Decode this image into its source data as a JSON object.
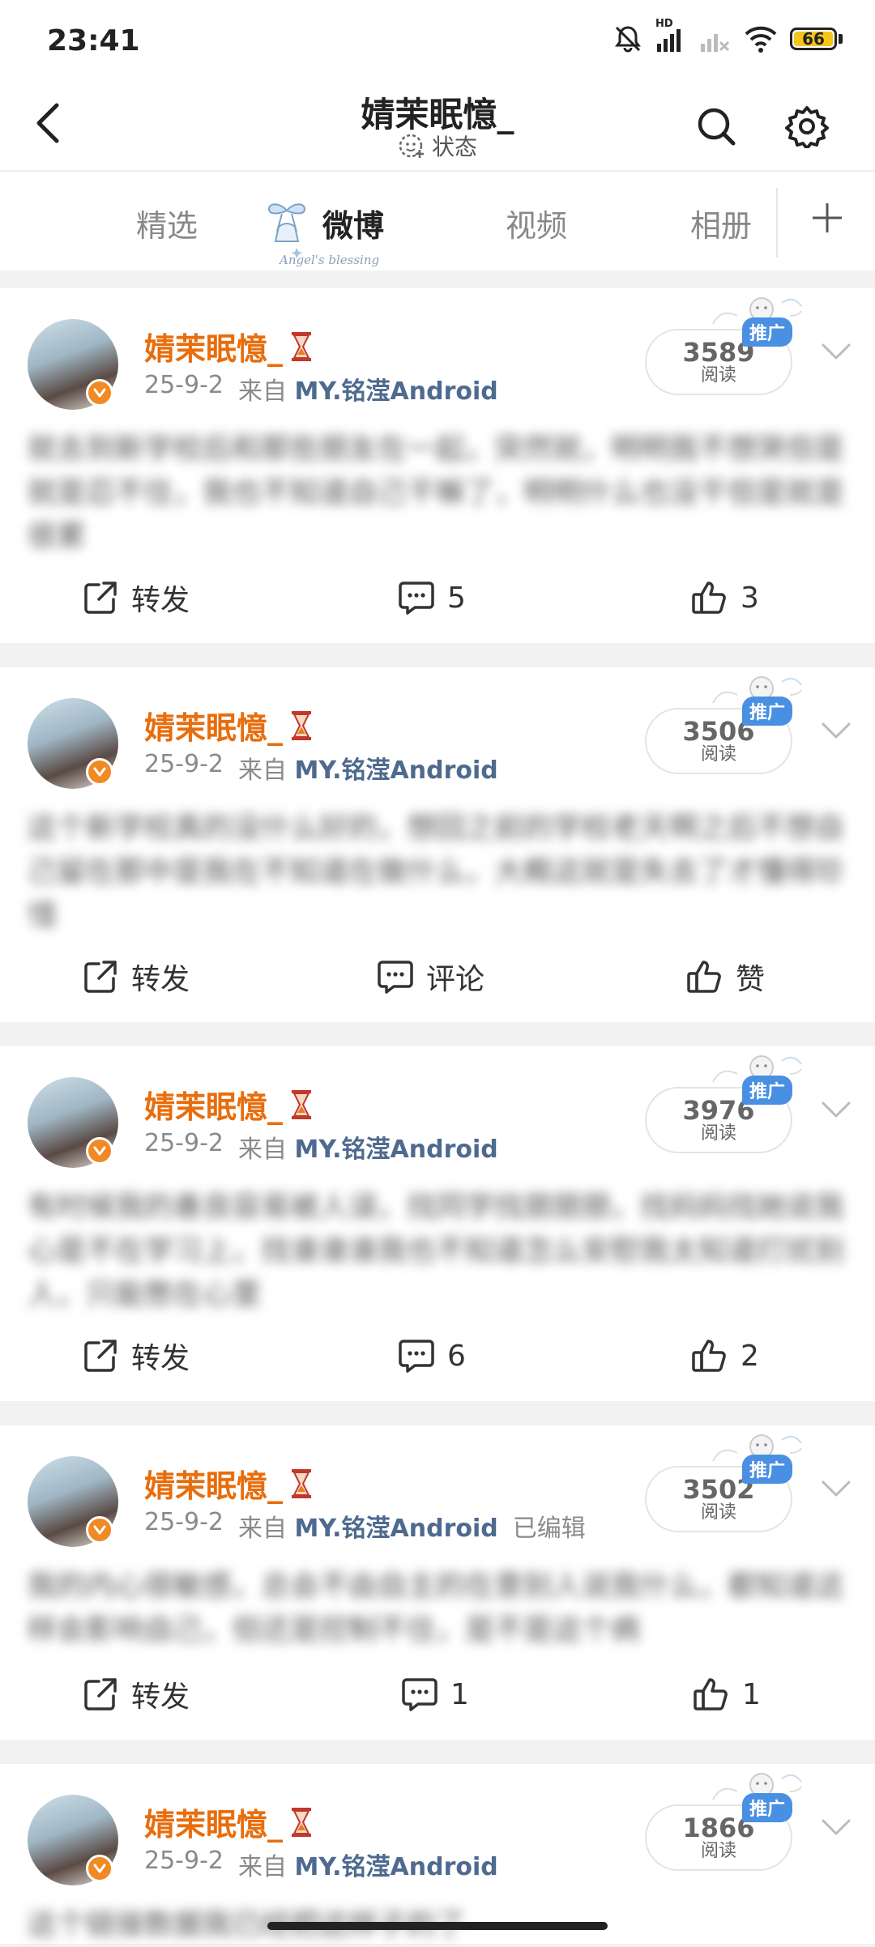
{
  "status_bar": {
    "time": "23:41",
    "network_label": "HD",
    "battery": "66",
    "icons": [
      "bell-mute-icon",
      "signal-icon",
      "signal-off-icon",
      "wifi-icon",
      "battery-icon"
    ]
  },
  "navbar": {
    "title": "婧茉眠憶_",
    "status_label": "状态",
    "icons": [
      "back-icon",
      "search-icon",
      "gear-icon"
    ]
  },
  "tabs": {
    "items": [
      "精选",
      "微博",
      "视频",
      "相册"
    ],
    "active": "微博",
    "deco_text": "Angel's blessing",
    "add_icon": "plus-icon"
  },
  "posts": [
    {
      "username": "婧茉眠憶_",
      "date": "25-9-2",
      "from_label": "来自",
      "source": "MY.铭滢Android",
      "edited_label": "",
      "read_count": "3589",
      "read_label": "阅读",
      "promo_label": "推广",
      "content": "就去到新学校后和那些朋友在一起，突然就，明明我不想哭但是就是忍不住，我也不知道自己干嘛了，明明什么也没干但是就是很累",
      "repost_label": "转发",
      "comment_label": "5",
      "like_label": "3"
    },
    {
      "username": "婧茉眠憶_",
      "date": "25-9-2",
      "from_label": "来自",
      "source": "MY.铭滢Android",
      "edited_label": "",
      "read_count": "3506",
      "read_label": "阅读",
      "promo_label": "推广",
      "content": "这个新学校真的没什么好的，想回之前的学校老天啊之后不想自己留在那中是我在不知道在做什么，大概这就是失去了才懂得珍惜",
      "repost_label": "转发",
      "comment_label": "评论",
      "like_label": "赞"
    },
    {
      "username": "婧茉眠憶_",
      "date": "25-9-2",
      "from_label": "来自",
      "source": "MY.铭滢Android",
      "edited_label": "",
      "read_count": "3976",
      "read_label": "阅读",
      "promo_label": "推广",
      "content": "有时候我的善良容易被人误，找同学找朋朋朋，找妈妈找她说我心是不在学习上，找谁谁谁我也不知道怎么安慰我太知道打扰别人，只能憋在心里",
      "repost_label": "转发",
      "comment_label": "6",
      "like_label": "2"
    },
    {
      "username": "婧茉眠憶_",
      "date": "25-9-2",
      "from_label": "来自",
      "source": "MY.铭滢Android",
      "edited_label": "已编辑",
      "read_count": "3502",
      "read_label": "阅读",
      "promo_label": "推广",
      "content": "我的内心很敏感，总会不由自主的在意别人说我什么，都知道这样会影响自己，但还是控制不住，是不是这个病",
      "repost_label": "转发",
      "comment_label": "1",
      "like_label": "1"
    },
    {
      "username": "婧茉眠憶_",
      "date": "25-9-2",
      "from_label": "来自",
      "source": "MY.铭滢Android",
      "edited_label": "",
      "read_count": "1866",
      "read_label": "阅读",
      "promo_label": "推广",
      "content": "这个链接数据我已经把这样子的了",
      "repost_label": "",
      "comment_label": "",
      "like_label": ""
    }
  ]
}
